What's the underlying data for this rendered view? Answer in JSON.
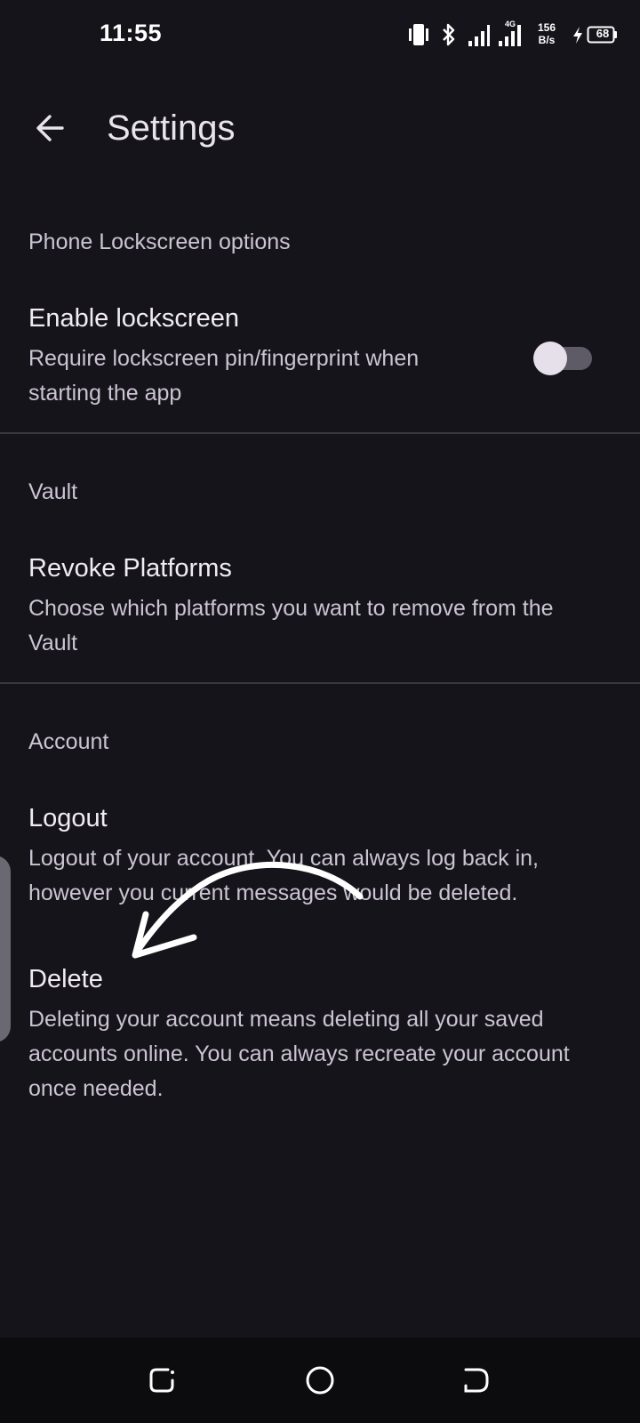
{
  "status_bar": {
    "time": "11:55",
    "network_type": "4G",
    "speed_value": "156",
    "speed_unit": "B/s",
    "battery_level": "68"
  },
  "app_bar": {
    "back_icon": "arrow-back-icon",
    "title": "Settings"
  },
  "sections": [
    {
      "header": "Phone Lockscreen options",
      "items": [
        {
          "title": "Enable lockscreen",
          "summary": "Require lockscreen pin/fingerprint when starting the app",
          "toggle_on": false
        }
      ]
    },
    {
      "header": "Vault",
      "items": [
        {
          "title": "Revoke Platforms",
          "summary": "Choose which platforms you want to remove from the Vault"
        }
      ]
    },
    {
      "header": "Account",
      "items": [
        {
          "title": "Logout",
          "summary": "Logout of your account. You can always log back in, however you current messages would be deleted."
        },
        {
          "title": "Delete",
          "summary": "Deleting your account means deleting all your saved accounts online. You can always recreate your account once needed."
        }
      ]
    }
  ],
  "nav_bar": {
    "recents_icon": "recents-icon",
    "home_icon": "home-circle-icon",
    "back_icon": "nav-back-icon"
  },
  "colors": {
    "background": "#16141b",
    "text_primary": "#f1ecf4",
    "text_secondary": "#cbc4d2",
    "divider": "#3a3740"
  }
}
